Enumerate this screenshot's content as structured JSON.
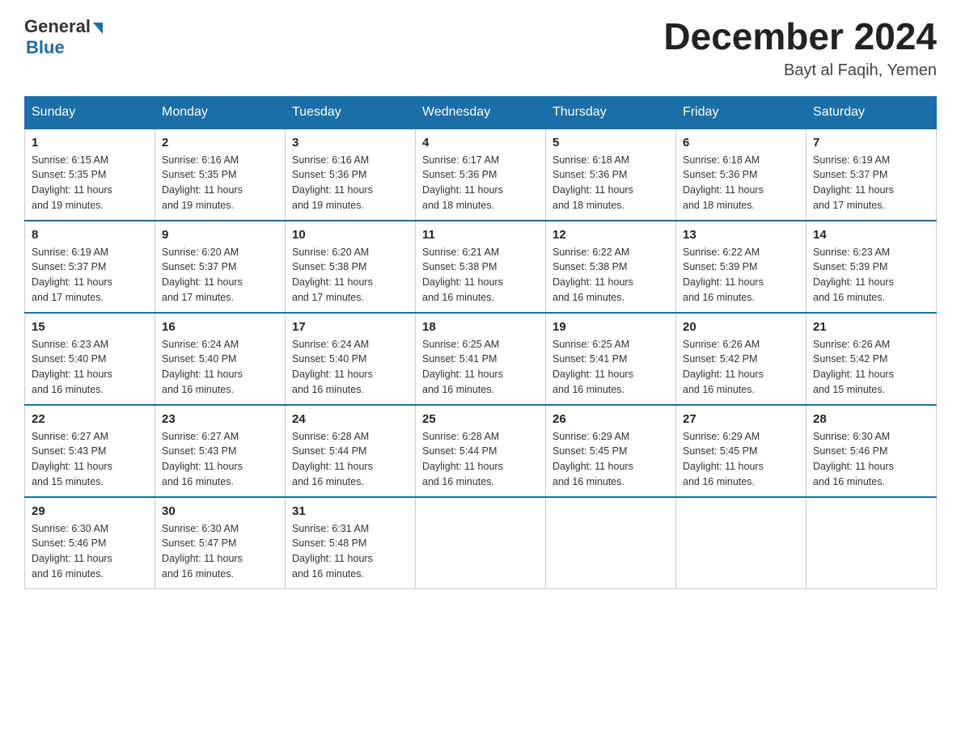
{
  "logo": {
    "general": "General",
    "blue": "Blue"
  },
  "title": "December 2024",
  "subtitle": "Bayt al Faqih, Yemen",
  "headers": [
    "Sunday",
    "Monday",
    "Tuesday",
    "Wednesday",
    "Thursday",
    "Friday",
    "Saturday"
  ],
  "weeks": [
    [
      {
        "day": "1",
        "sunrise": "6:15 AM",
        "sunset": "5:35 PM",
        "daylight": "11 hours and 19 minutes."
      },
      {
        "day": "2",
        "sunrise": "6:16 AM",
        "sunset": "5:35 PM",
        "daylight": "11 hours and 19 minutes."
      },
      {
        "day": "3",
        "sunrise": "6:16 AM",
        "sunset": "5:36 PM",
        "daylight": "11 hours and 19 minutes."
      },
      {
        "day": "4",
        "sunrise": "6:17 AM",
        "sunset": "5:36 PM",
        "daylight": "11 hours and 18 minutes."
      },
      {
        "day": "5",
        "sunrise": "6:18 AM",
        "sunset": "5:36 PM",
        "daylight": "11 hours and 18 minutes."
      },
      {
        "day": "6",
        "sunrise": "6:18 AM",
        "sunset": "5:36 PM",
        "daylight": "11 hours and 18 minutes."
      },
      {
        "day": "7",
        "sunrise": "6:19 AM",
        "sunset": "5:37 PM",
        "daylight": "11 hours and 17 minutes."
      }
    ],
    [
      {
        "day": "8",
        "sunrise": "6:19 AM",
        "sunset": "5:37 PM",
        "daylight": "11 hours and 17 minutes."
      },
      {
        "day": "9",
        "sunrise": "6:20 AM",
        "sunset": "5:37 PM",
        "daylight": "11 hours and 17 minutes."
      },
      {
        "day": "10",
        "sunrise": "6:20 AM",
        "sunset": "5:38 PM",
        "daylight": "11 hours and 17 minutes."
      },
      {
        "day": "11",
        "sunrise": "6:21 AM",
        "sunset": "5:38 PM",
        "daylight": "11 hours and 16 minutes."
      },
      {
        "day": "12",
        "sunrise": "6:22 AM",
        "sunset": "5:38 PM",
        "daylight": "11 hours and 16 minutes."
      },
      {
        "day": "13",
        "sunrise": "6:22 AM",
        "sunset": "5:39 PM",
        "daylight": "11 hours and 16 minutes."
      },
      {
        "day": "14",
        "sunrise": "6:23 AM",
        "sunset": "5:39 PM",
        "daylight": "11 hours and 16 minutes."
      }
    ],
    [
      {
        "day": "15",
        "sunrise": "6:23 AM",
        "sunset": "5:40 PM",
        "daylight": "11 hours and 16 minutes."
      },
      {
        "day": "16",
        "sunrise": "6:24 AM",
        "sunset": "5:40 PM",
        "daylight": "11 hours and 16 minutes."
      },
      {
        "day": "17",
        "sunrise": "6:24 AM",
        "sunset": "5:40 PM",
        "daylight": "11 hours and 16 minutes."
      },
      {
        "day": "18",
        "sunrise": "6:25 AM",
        "sunset": "5:41 PM",
        "daylight": "11 hours and 16 minutes."
      },
      {
        "day": "19",
        "sunrise": "6:25 AM",
        "sunset": "5:41 PM",
        "daylight": "11 hours and 16 minutes."
      },
      {
        "day": "20",
        "sunrise": "6:26 AM",
        "sunset": "5:42 PM",
        "daylight": "11 hours and 16 minutes."
      },
      {
        "day": "21",
        "sunrise": "6:26 AM",
        "sunset": "5:42 PM",
        "daylight": "11 hours and 15 minutes."
      }
    ],
    [
      {
        "day": "22",
        "sunrise": "6:27 AM",
        "sunset": "5:43 PM",
        "daylight": "11 hours and 15 minutes."
      },
      {
        "day": "23",
        "sunrise": "6:27 AM",
        "sunset": "5:43 PM",
        "daylight": "11 hours and 16 minutes."
      },
      {
        "day": "24",
        "sunrise": "6:28 AM",
        "sunset": "5:44 PM",
        "daylight": "11 hours and 16 minutes."
      },
      {
        "day": "25",
        "sunrise": "6:28 AM",
        "sunset": "5:44 PM",
        "daylight": "11 hours and 16 minutes."
      },
      {
        "day": "26",
        "sunrise": "6:29 AM",
        "sunset": "5:45 PM",
        "daylight": "11 hours and 16 minutes."
      },
      {
        "day": "27",
        "sunrise": "6:29 AM",
        "sunset": "5:45 PM",
        "daylight": "11 hours and 16 minutes."
      },
      {
        "day": "28",
        "sunrise": "6:30 AM",
        "sunset": "5:46 PM",
        "daylight": "11 hours and 16 minutes."
      }
    ],
    [
      {
        "day": "29",
        "sunrise": "6:30 AM",
        "sunset": "5:46 PM",
        "daylight": "11 hours and 16 minutes."
      },
      {
        "day": "30",
        "sunrise": "6:30 AM",
        "sunset": "5:47 PM",
        "daylight": "11 hours and 16 minutes."
      },
      {
        "day": "31",
        "sunrise": "6:31 AM",
        "sunset": "5:48 PM",
        "daylight": "11 hours and 16 minutes."
      },
      null,
      null,
      null,
      null
    ]
  ],
  "labels": {
    "sunrise": "Sunrise:",
    "sunset": "Sunset:",
    "daylight": "Daylight:"
  }
}
